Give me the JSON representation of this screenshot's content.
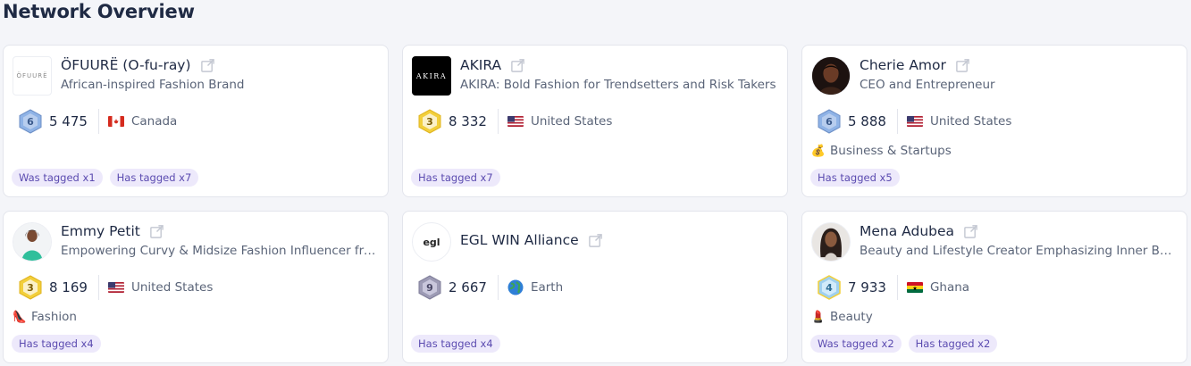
{
  "page_title": "Network Overview",
  "cards": [
    {
      "name": "ÖFUURË (O-fu-ray)",
      "description": "African-inspired Fashion Brand",
      "avatar_text": "ÖFUURË",
      "level": "6",
      "level_color": "#8fb3e6",
      "followers": "5 475",
      "country": "Canada",
      "category_icon": "",
      "category": "",
      "tags": [
        "Was tagged x1",
        "Has tagged x7"
      ]
    },
    {
      "name": "AKIRA",
      "description": "AKIRA: Bold Fashion for Trendsetters and Risk Takers",
      "avatar_text": "AKIRA",
      "level": "3",
      "level_color": "#f2cf3b",
      "followers": "8 332",
      "country": "United States",
      "category_icon": "",
      "category": "",
      "tags": [
        "Has tagged x7"
      ]
    },
    {
      "name": "Cherie Amor",
      "description": "CEO and Entrepreneur",
      "avatar_text": "",
      "level": "6",
      "level_color": "#8fb3e6",
      "followers": "5 888",
      "country": "United States",
      "category_icon": "💰",
      "category": "Business & Startups",
      "tags": [
        "Has tagged x5"
      ]
    },
    {
      "name": "Emmy Petit",
      "description": "Empowering Curvy & Midsize Fashion Influencer fro...",
      "avatar_text": "",
      "level": "3",
      "level_color": "#f2cf3b",
      "followers": "8 169",
      "country": "United States",
      "category_icon": "👠",
      "category": "Fashion",
      "tags": [
        "Has tagged x4"
      ]
    },
    {
      "name": "EGL WIN Alliance",
      "description": "",
      "avatar_text": "egl",
      "level": "9",
      "level_color": "#9d9bb5",
      "followers": "2 667",
      "country": "Earth",
      "category_icon": "",
      "category": "",
      "tags": [
        "Has tagged x4"
      ]
    },
    {
      "name": "Mena Adubea",
      "description": "Beauty and Lifestyle Creator Emphasizing Inner Bea...",
      "avatar_text": "",
      "level": "4",
      "level_color": "#9fd0ef",
      "followers": "7 933",
      "country": "Ghana",
      "category_icon": "💄",
      "category": "Beauty",
      "tags": [
        "Was tagged x2",
        "Has tagged x2"
      ]
    }
  ]
}
